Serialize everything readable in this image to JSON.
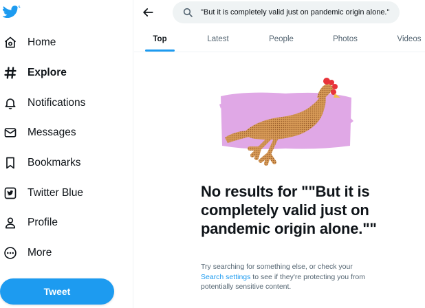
{
  "sidebar": {
    "logo": "twitter-bird-icon",
    "items": [
      {
        "label": "Home",
        "icon": "home-icon"
      },
      {
        "label": "Explore",
        "icon": "hashtag-icon"
      },
      {
        "label": "Notifications",
        "icon": "bell-icon"
      },
      {
        "label": "Messages",
        "icon": "envelope-icon"
      },
      {
        "label": "Bookmarks",
        "icon": "bookmark-icon"
      },
      {
        "label": "Twitter Blue",
        "icon": "twitter-blue-icon"
      },
      {
        "label": "Profile",
        "icon": "person-icon"
      },
      {
        "label": "More",
        "icon": "more-circle-icon"
      }
    ],
    "active_item": "Explore",
    "tweet_label": "Tweet"
  },
  "header": {
    "search_value": "\"But it is completely valid just on pandemic origin alone.\"",
    "tabs": [
      {
        "label": "Top"
      },
      {
        "label": "Latest"
      },
      {
        "label": "People"
      },
      {
        "label": "Photos"
      },
      {
        "label": "Videos"
      }
    ],
    "active_tab": "Top"
  },
  "empty_state": {
    "illustration": "rubber-chicken-illustration",
    "heading": "No results for \"\"But it is completely valid just on pandemic origin alone.\"\"",
    "sub_before": "Try searching for something else, or check your ",
    "sub_link": "Search settings",
    "sub_after": " to see if they're protecting you from potentially sensitive content."
  },
  "colors": {
    "accent": "#1d9bf0",
    "text": "#0f1419",
    "secondary_text": "#536471",
    "search_bg": "#eff3f4",
    "illustration_bg": "#e0a8e6"
  }
}
